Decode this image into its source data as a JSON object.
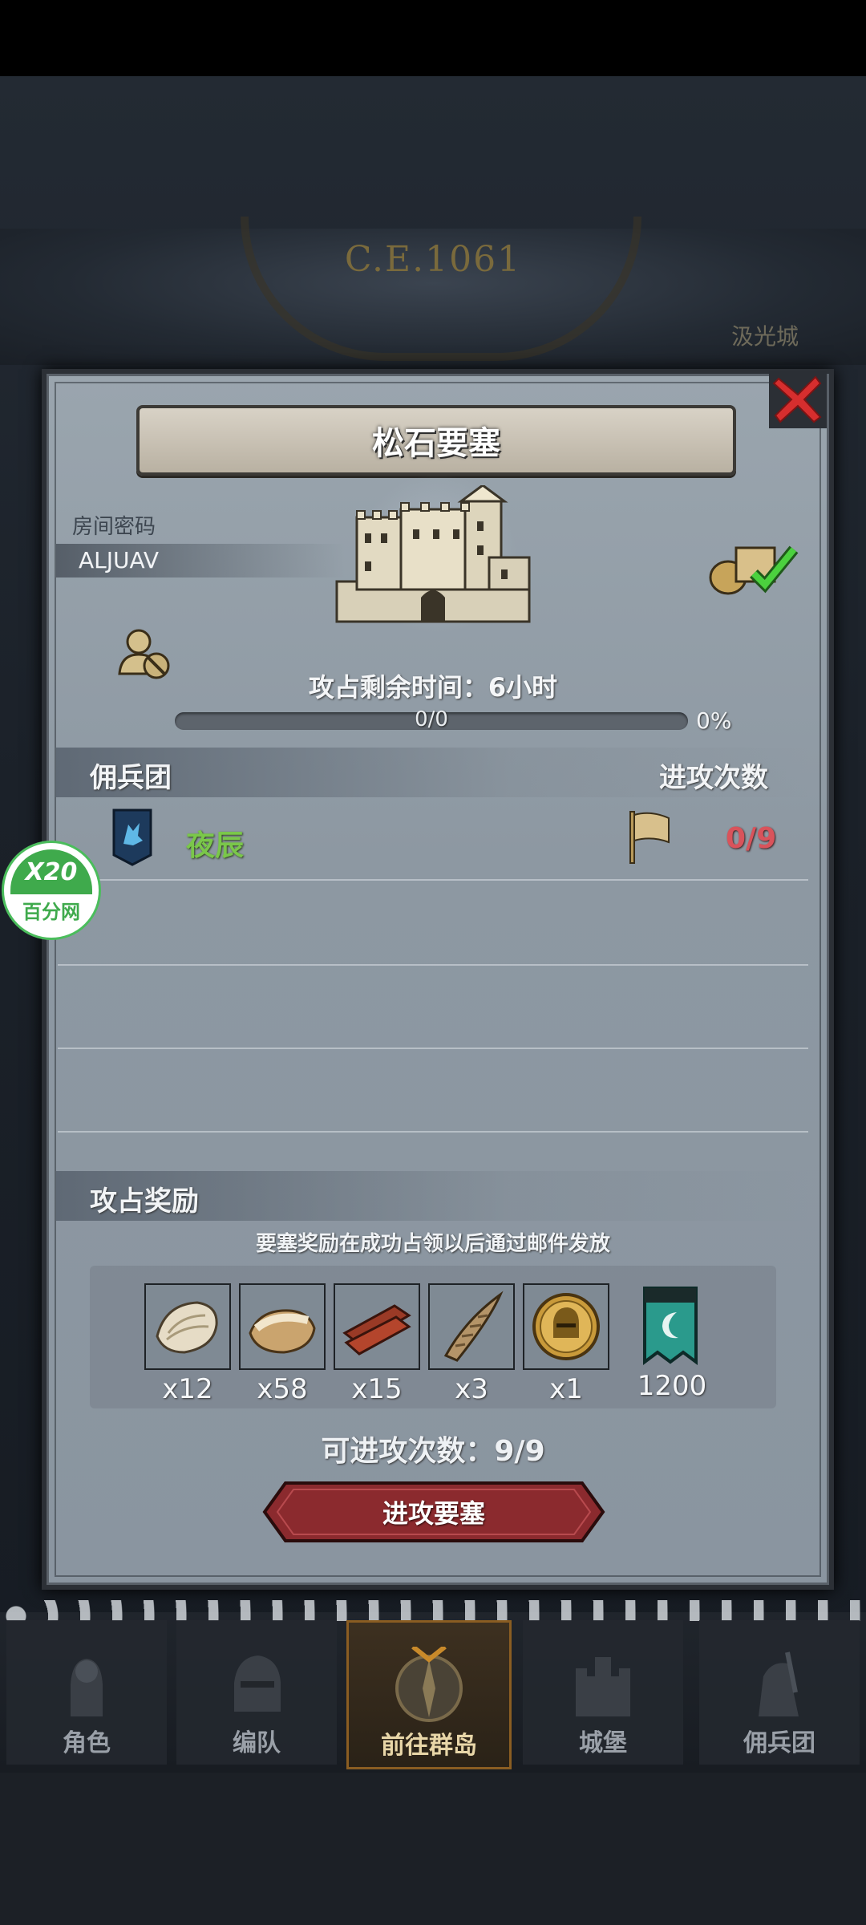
{
  "era": {
    "title": "C.E.1061",
    "right_label": "汲光城"
  },
  "dialog": {
    "title": "松石要塞",
    "room_password_label": "房间密码",
    "room_password": "ALJUAV",
    "remaining_label": "攻占剩余时间：6小时",
    "progress_text": "0/0",
    "progress_fraction": 0,
    "percent": "0%"
  },
  "mercenary": {
    "section_title": "佣兵团",
    "attack_header": "进攻次数",
    "rows": [
      {
        "name": "夜辰",
        "count": "0/9"
      }
    ]
  },
  "rewards": {
    "section_title": "攻占奖励",
    "note": "要塞奖励在成功占领以后通过邮件发放",
    "items": [
      {
        "icon": "fur-pelt-icon",
        "qty": "x12"
      },
      {
        "icon": "leather-hide-icon",
        "qty": "x58"
      },
      {
        "icon": "wood-planks-icon",
        "qty": "x15"
      },
      {
        "icon": "horn-icon",
        "qty": "x3"
      },
      {
        "icon": "knight-helmet-coin-icon",
        "qty": "x1"
      },
      {
        "icon": "guild-banner-icon",
        "qty": "1200"
      }
    ]
  },
  "attempts": "可进攻次数：9/9",
  "attack_button": "进攻要塞",
  "watermark": {
    "top": "X20",
    "bottom": "百分网"
  },
  "nav": [
    {
      "label": "角色",
      "icon": "knight-icon"
    },
    {
      "label": "编队",
      "icon": "helmet-icon"
    },
    {
      "label": "前往群岛",
      "icon": "compass-icon"
    },
    {
      "label": "城堡",
      "icon": "castle-icon"
    },
    {
      "label": "佣兵团",
      "icon": "mercenary-icon"
    }
  ],
  "colors": {
    "guild_name": "#7ac74a",
    "attack_count": "#d9535b",
    "button": "#8b2a2e"
  }
}
